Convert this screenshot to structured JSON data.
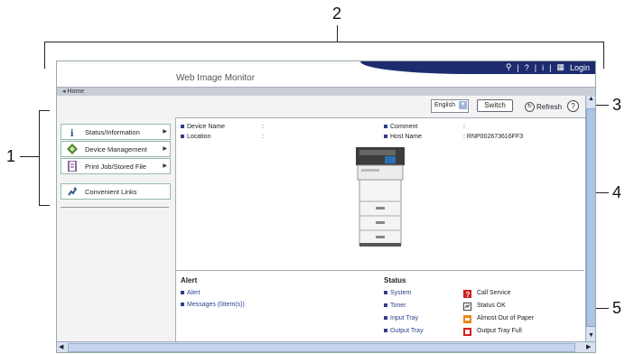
{
  "callouts": {
    "c1": "1",
    "c2": "2",
    "c3": "3",
    "c4": "4",
    "c5": "5"
  },
  "header": {
    "app_title": "Web Image Monitor",
    "search_icon": "search-icon",
    "help_label": "?",
    "info_label": "i",
    "login_label": "Login"
  },
  "nav": {
    "home": "Home"
  },
  "toolbar": {
    "language_value": "English",
    "switch_label": "Switch",
    "refresh_label": "Refresh",
    "help_label": "?"
  },
  "sidebar": {
    "items": [
      {
        "label": "Status/Information",
        "icon": "info-icon"
      },
      {
        "label": "Device Management",
        "icon": "device-management-icon"
      },
      {
        "label": "Print Job/Stored File",
        "icon": "print-job-icon"
      },
      {
        "label": "Convenient Links",
        "icon": "link-icon"
      }
    ]
  },
  "device_info": {
    "device_name_label": "Device Name",
    "device_name_value": ":",
    "location_label": "Location",
    "location_value": ":",
    "comment_label": "Comment",
    "comment_value": ":",
    "host_name_label": "Host Name",
    "host_name_value": ": RNP002673616FF3"
  },
  "alert": {
    "title": "Alert",
    "links": [
      "Alert",
      "Messages (0item(s))"
    ]
  },
  "status": {
    "title": "Status",
    "links": [
      "System",
      "Toner",
      "Input Tray",
      "Output Tray"
    ],
    "legend": [
      {
        "label": "Call Service",
        "icon": "call-service-icon",
        "color": "#d21f1f"
      },
      {
        "label": "Status OK",
        "icon": "status-ok-icon",
        "color": "#444444"
      },
      {
        "label": "Almost Out of Paper",
        "icon": "almost-out-of-paper-icon",
        "color": "#e8861b"
      },
      {
        "label": "Output Tray Full",
        "icon": "output-tray-full-icon",
        "color": "#d21f1f"
      }
    ]
  },
  "colors": {
    "banner": "#1d2c6e",
    "link": "#2d3f8e",
    "scroll": "#aec4e4"
  }
}
